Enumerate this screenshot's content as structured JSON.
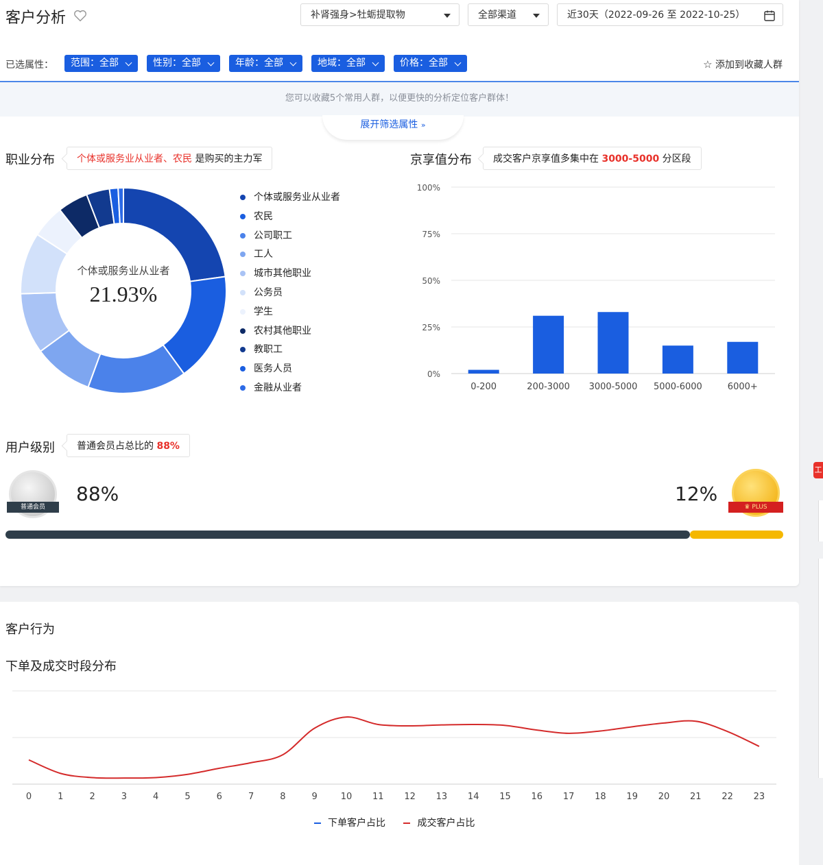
{
  "header": {
    "title": "客户分析",
    "category_select": "补肾强身>牡蛎提取物",
    "channel_select": "全部渠道",
    "date_range": "近30天（2022-09-26 至 2022-10-25）"
  },
  "filters": {
    "label": "已选属性：",
    "chips": [
      "范围：全部",
      "性别：全部",
      "年龄：全部",
      "地域：全部",
      "价格：全部"
    ],
    "add_favorite": "添加到收藏人群"
  },
  "banner": {
    "text": "您可以收藏5个常用人群，以便更快的分析定位客户群体！",
    "expand": "展开筛选属性"
  },
  "occupation": {
    "title": "职业分布",
    "callout_highlight": "个体或服务业从业者、农民",
    "callout_rest": "是购买的主力军",
    "center_label": "个体或服务业从业者",
    "center_value": "21.93%"
  },
  "jingxiang": {
    "title": "京享值分布",
    "callout_prefix": "成交客户京享值多集中在",
    "callout_highlight": "3000-5000",
    "callout_suffix": "分区段"
  },
  "user_level": {
    "title": "用户级别",
    "callout_prefix": "普通会员占总比的",
    "callout_highlight": "88%",
    "normal_label": "普通会员",
    "normal_pct": "88%",
    "plus_label": "PLUS",
    "plus_pct": "12%",
    "normal_share": 0.88,
    "plus_share": 0.12
  },
  "behavior": {
    "title": "客户行为",
    "subtitle": "下单及成交时段分布"
  },
  "colors": {
    "primary": "#1a5ee0",
    "red": "#e8312a",
    "dark_bar": "#2f3e4a",
    "gold": "#f5b800"
  },
  "chart_data": [
    {
      "type": "pie",
      "labels": [
        "个体或服务业从业者",
        "农民",
        "公司职工",
        "工人",
        "城市其他职业",
        "公务员",
        "学生",
        "农村其他职业",
        "教职工",
        "医务人员",
        "金融从业者"
      ],
      "values": [
        21.93,
        16.5,
        15.0,
        9.0,
        9.2,
        9.3,
        5.0,
        4.6,
        3.5,
        1.3,
        0.8
      ],
      "colors": [
        "#1445b0",
        "#1a5ee0",
        "#4b82ea",
        "#7ea6f0",
        "#a9c3f5",
        "#d2e1fa",
        "#ecf2fd",
        "#0d2a66",
        "#123a8f",
        "#1a5ee0",
        "#2d6be6"
      ],
      "donut": true
    },
    {
      "type": "bar",
      "categories": [
        "0-200",
        "200-3000",
        "3000-5000",
        "5000-6000",
        "6000+"
      ],
      "values": [
        2,
        31,
        33,
        15,
        17
      ],
      "yticks": [
        "0%",
        "25%",
        "50%",
        "75%",
        "100%"
      ],
      "ylim": [
        0,
        100
      ]
    },
    {
      "type": "line",
      "x": [
        "0",
        "1",
        "2",
        "3",
        "4",
        "5",
        "6",
        "7",
        "8",
        "9",
        "10",
        "11",
        "12",
        "13",
        "14",
        "15",
        "16",
        "17",
        "18",
        "19",
        "20",
        "21",
        "22",
        "23"
      ],
      "series": [
        {
          "name": "下单客户占比",
          "color": "#1a5ee0",
          "values": []
        },
        {
          "name": "成交客户占比",
          "color": "#d42a2a",
          "values": [
            5.2,
            2.3,
            1.4,
            1.3,
            1.4,
            2.1,
            3.4,
            4.6,
            6.3,
            12.0,
            14.4,
            12.8,
            12.5,
            12.7,
            12.8,
            12.6,
            11.6,
            10.9,
            11.4,
            12.3,
            13.1,
            13.5,
            11.3,
            8.1
          ]
        }
      ],
      "ylim": [
        0,
        20
      ]
    }
  ]
}
